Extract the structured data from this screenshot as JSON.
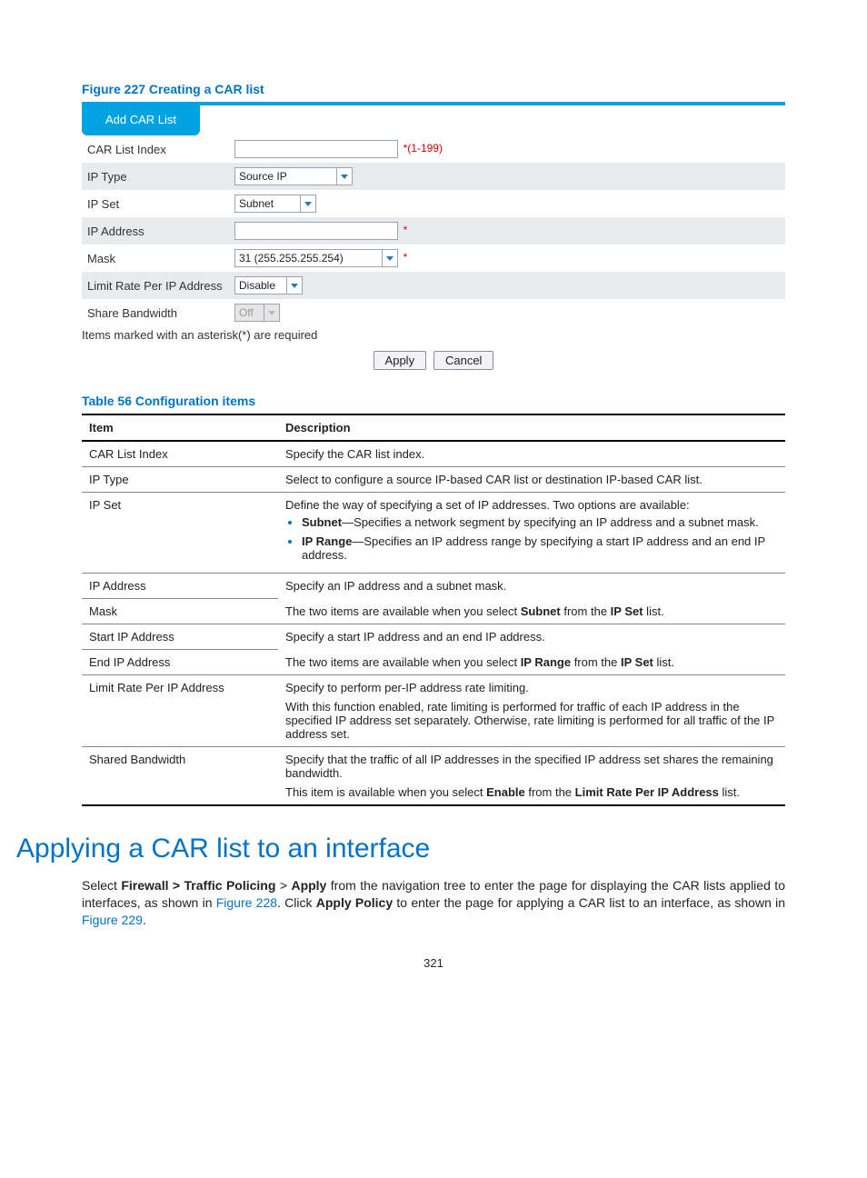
{
  "figure_caption": "Figure 227 Creating a CAR list",
  "form": {
    "tab_label": "Add CAR List",
    "rows": {
      "car_list_index": {
        "label": "CAR List Index",
        "hint": "*(1-199)"
      },
      "ip_type": {
        "label": "IP Type",
        "value": "Source IP"
      },
      "ip_set": {
        "label": "IP Set",
        "value": "Subnet"
      },
      "ip_address": {
        "label": "IP Address",
        "hint": "*"
      },
      "mask": {
        "label": "Mask",
        "value": "31 (255.255.255.254)",
        "hint": "*"
      },
      "limit_rate": {
        "label": "Limit Rate Per IP Address",
        "value": "Disable"
      },
      "share_bw": {
        "label": "Share Bandwidth",
        "value": "Off"
      }
    },
    "required_note": "Items marked with an asterisk(*) are required",
    "apply_btn": "Apply",
    "cancel_btn": "Cancel"
  },
  "table_caption": "Table 56 Configuration items",
  "table": {
    "headers": {
      "item": "Item",
      "desc": "Description"
    },
    "rows": {
      "car_list_index": {
        "item": "CAR List Index",
        "desc": "Specify the CAR list index."
      },
      "ip_type": {
        "item": "IP Type",
        "desc": "Select to configure a source IP-based CAR list or destination IP-based CAR list."
      },
      "ip_set": {
        "item": "IP Set",
        "intro": "Define the way of specifying a set of IP addresses. Two options are available:",
        "b1_label": "Subnet",
        "b1_rest": "—Specifies a network segment by specifying an IP address and a subnet mask.",
        "b2_label": "IP Range",
        "b2_rest": "—Specifies an IP address range by specifying a start IP address and an end IP address."
      },
      "ip_address": {
        "item": "IP Address",
        "line1": "Specify an IP address and a subnet mask."
      },
      "mask": {
        "item": "Mask",
        "line2a": "The two items are available when you select ",
        "line2b": "Subnet",
        "line2c": " from the ",
        "line2d": "IP Set",
        "line2e": " list."
      },
      "start_ip": {
        "item": "Start IP Address",
        "line1": "Specify a start IP address and an end IP address."
      },
      "end_ip": {
        "item": "End IP Address",
        "line2a": "The two items are available when you select ",
        "line2b": "IP Range",
        "line2c": " from the ",
        "line2d": "IP Set",
        "line2e": " list."
      },
      "limit_rate": {
        "item": "Limit Rate Per IP Address",
        "p1": "Specify to perform per-IP address rate limiting.",
        "p2": "With this function enabled, rate limiting is performed for traffic of each IP address in the specified IP address set separately. Otherwise, rate limiting is performed for all traffic of the IP address set."
      },
      "shared_bw": {
        "item": "Shared Bandwidth",
        "p1": "Specify that the traffic of all IP addresses in the specified IP address set shares the remaining bandwidth.",
        "p2a": "This item is available when you select ",
        "p2b": "Enable",
        "p2c": " from the ",
        "p2d": "Limit Rate Per IP Address",
        "p2e": " list."
      }
    }
  },
  "section_heading": "Applying a CAR list to an interface",
  "body": {
    "t1": "Select ",
    "t2": "Firewall > Traffic Policing",
    "t3": " > ",
    "t4": "Apply",
    "t5": " from the navigation tree to enter the page for displaying the CAR lists applied to interfaces, as shown in ",
    "link1": "Figure 228",
    "t6": ". Click ",
    "t7": "Apply Policy",
    "t8": " to enter the page for applying a CAR list to an interface, as shown in ",
    "link2": "Figure 229",
    "t9": "."
  },
  "page_number": "321"
}
